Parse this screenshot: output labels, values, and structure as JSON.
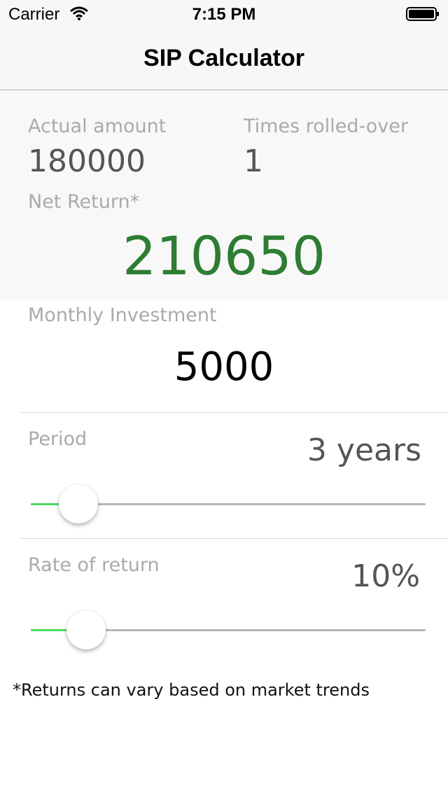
{
  "status_bar": {
    "carrier": "Carrier",
    "time": "7:15 PM",
    "wifi_icon": "wifi-icon",
    "battery_icon": "battery-icon"
  },
  "nav": {
    "title": "SIP Calculator"
  },
  "summary": {
    "actual_amount_label": "Actual amount",
    "actual_amount_value": "180000",
    "times_rolled_over_label": "Times rolled-over",
    "times_rolled_over_value": "1",
    "net_return_label": "Net Return*",
    "net_return_value": "210650"
  },
  "monthly_investment": {
    "label": "Monthly Investment",
    "value": "5000"
  },
  "period": {
    "label": "Period",
    "value_text": "3 years",
    "slider_fraction": 0.12
  },
  "rate_of_return": {
    "label": "Rate of return",
    "value_text": "10%",
    "slider_fraction": 0.14
  },
  "footnote": "*Returns can vary based on market trends",
  "colors": {
    "accent_green": "#2e7d32",
    "slider_fill": "#4cd964",
    "label_gray": "#aaaaaa",
    "bar_background": "#f7f7f7"
  }
}
